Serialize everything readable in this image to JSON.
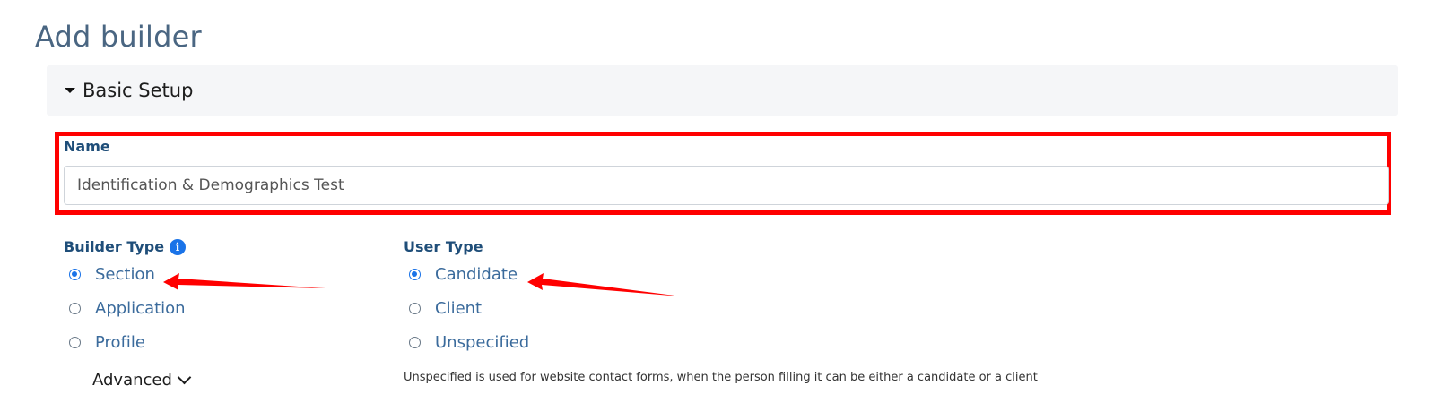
{
  "page": {
    "title": "Add builder"
  },
  "section": {
    "title": "Basic Setup"
  },
  "name_field": {
    "label": "Name",
    "value": "Identification & Demographics Test"
  },
  "builder_type": {
    "label": "Builder Type",
    "info_icon": "info-icon",
    "options": [
      {
        "label": "Section",
        "checked": true
      },
      {
        "label": "Application",
        "checked": false
      },
      {
        "label": "Profile",
        "checked": false
      }
    ],
    "advanced_label": "Advanced"
  },
  "user_type": {
    "label": "User Type",
    "options": [
      {
        "label": "Candidate",
        "checked": true
      },
      {
        "label": "Client",
        "checked": false
      },
      {
        "label": "Unspecified",
        "checked": false
      }
    ],
    "help_text": "Unspecified is used for website contact forms, when the person filling it can be either a candidate or a client"
  },
  "colors": {
    "annotation": "#ff0000",
    "accent": "#1a73e8",
    "label": "#1f4e79",
    "title": "#4a6682"
  }
}
